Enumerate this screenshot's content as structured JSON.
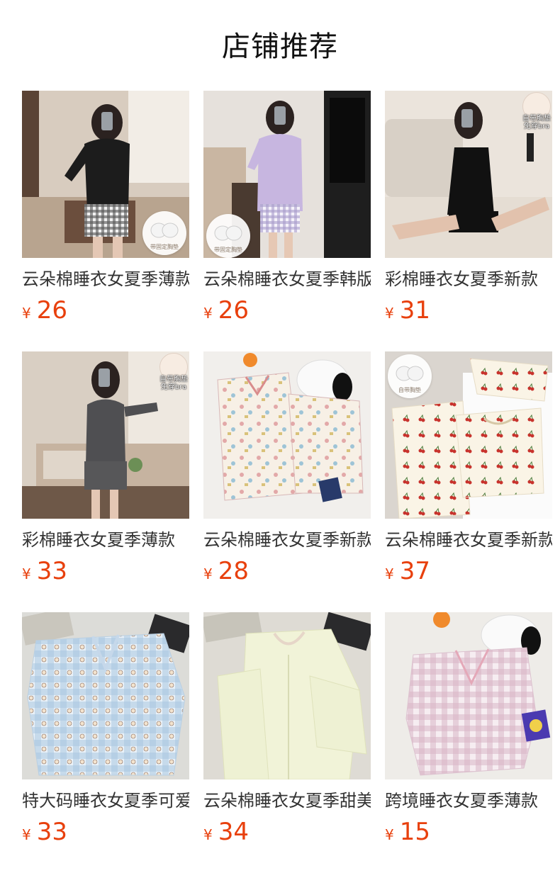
{
  "section": {
    "title": "店铺推荐"
  },
  "currency": "¥",
  "products": [
    {
      "name": "云朵棉睡衣女夏季薄款",
      "price": "26"
    },
    {
      "name": "云朵棉睡衣女夏季韩版",
      "price": "26"
    },
    {
      "name": "彩棉睡衣女夏季新款",
      "price": "31"
    },
    {
      "name": "彩棉睡衣女夏季薄款",
      "price": "33"
    },
    {
      "name": "云朵棉睡衣女夏季新款",
      "price": "28"
    },
    {
      "name": "云朵棉睡衣女夏季新款",
      "price": "37"
    },
    {
      "name": "特大码睡衣女夏季可爱",
      "price": "33"
    },
    {
      "name": "云朵棉睡衣女夏季甜美",
      "price": "34"
    },
    {
      "name": "跨境睡衣女夏季薄款",
      "price": "15"
    }
  ],
  "badges": {
    "pad_fixed": "带固定胸垫",
    "built_in_pad": "自带胸垫",
    "no_bra": "免穿bra"
  },
  "colors": {
    "price": "#e8400d",
    "title": "#111111"
  }
}
